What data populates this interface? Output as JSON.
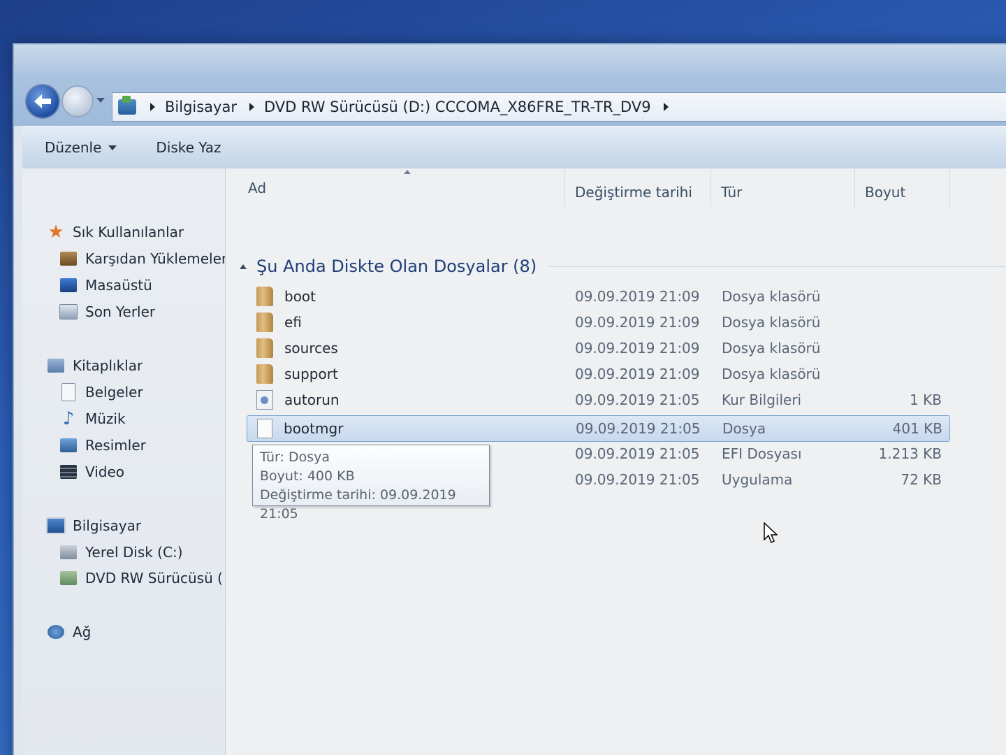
{
  "address": {
    "crumbs": [
      "Bilgisayar",
      "DVD RW Sürücüsü (D:) CCCOMA_X86FRE_TR-TR_DV9"
    ]
  },
  "commandbar": {
    "organize_label": "Düzenle",
    "burn_label": "Diske Yaz"
  },
  "navpane": {
    "favorites": {
      "label": "Sık Kullanılanlar",
      "items": [
        "Karşıdan Yüklemeler",
        "Masaüstü",
        "Son Yerler"
      ]
    },
    "libraries": {
      "label": "Kitaplıklar",
      "items": [
        "Belgeler",
        "Müzik",
        "Resimler",
        "Video"
      ]
    },
    "computer": {
      "label": "Bilgisayar",
      "items": [
        "Yerel Disk (C:)",
        "DVD RW Sürücüsü (D:)"
      ]
    },
    "network": {
      "label": "Ağ"
    }
  },
  "columns": {
    "name": "Ad",
    "date": "Değiştirme tarihi",
    "type": "Tür",
    "size": "Boyut"
  },
  "group": {
    "label": "Şu Anda Diskte Olan Dosyalar (8)"
  },
  "files": [
    {
      "name": "boot",
      "date": "09.09.2019 21:09",
      "type": "Dosya klasörü",
      "size": "",
      "icon": "folder-icon"
    },
    {
      "name": "efi",
      "date": "09.09.2019 21:09",
      "type": "Dosya klasörü",
      "size": "",
      "icon": "folder-icon"
    },
    {
      "name": "sources",
      "date": "09.09.2019 21:09",
      "type": "Dosya klasörü",
      "size": "",
      "icon": "folder-icon"
    },
    {
      "name": "support",
      "date": "09.09.2019 21:09",
      "type": "Dosya klasörü",
      "size": "",
      "icon": "folder-icon"
    },
    {
      "name": "autorun",
      "date": "09.09.2019 21:05",
      "type": "Kur Bilgileri",
      "size": "1 KB",
      "icon": "setup-info-icon"
    },
    {
      "name": "bootmgr",
      "date": "09.09.2019 21:05",
      "type": "Dosya",
      "size": "401 KB",
      "icon": "file-icon"
    },
    {
      "name": "",
      "date": "09.09.2019 21:05",
      "type": "EFI Dosyası",
      "size": "1.213 KB",
      "icon": ""
    },
    {
      "name": "",
      "date": "09.09.2019 21:05",
      "type": "Uygulama",
      "size": "72 KB",
      "icon": ""
    }
  ],
  "tooltip": {
    "type_line": "Tür: Dosya",
    "size_line": "Boyut: 400 KB",
    "date_line": "Değiştirme tarihi: 09.09.2019 21:05"
  }
}
